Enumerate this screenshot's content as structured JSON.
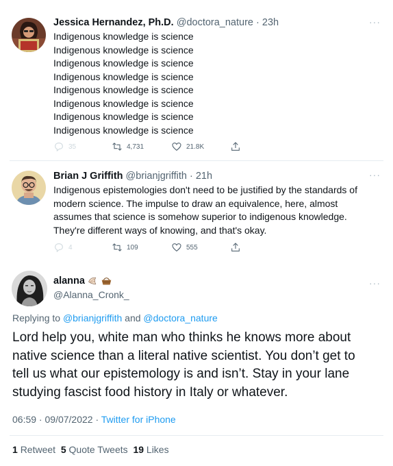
{
  "tweet1": {
    "name": "Jessica Hernandez, Ph.D.",
    "handle": "@doctora_nature",
    "time": "23h",
    "lines": [
      "Indigenous knowledge is science",
      "Indigenous knowledge is science",
      "Indigenous knowledge is science",
      "Indigenous knowledge is science",
      "Indigenous knowledge is science",
      "Indigenous knowledge is science",
      "Indigenous knowledge is science",
      "Indigenous knowledge is science"
    ],
    "replies": "35",
    "retweets": "4,731",
    "likes": "21.8K"
  },
  "tweet2": {
    "name": "Brian J Griffith",
    "handle": "@brianjgriffith",
    "time": "21h",
    "lines": [
      "Indigenous epistemologies don't need to be justified by the standards of",
      "modern science. The impulse to draw an equivalence, here, almost",
      "assumes that science is somehow superior to indigenous knowledge.",
      "They're different ways of knowing, and that's okay."
    ],
    "replies": "4",
    "retweets": "109",
    "likes": "555"
  },
  "tweet3": {
    "name": "alanna",
    "handle": "@Alanna_Cronk_",
    "replying_prefix": "Replying to",
    "replying_user1": "@brianjgriffith",
    "replying_and": "and",
    "replying_user2": "@doctora_nature",
    "lines": [
      "Lord help you, white man who thinks he knows more about",
      "native science than a literal native scientist. You don’t get to",
      "tell us what our epistemology is and isn’t. Stay in your lane",
      "studying fascist food history in Italy or whatever."
    ],
    "time": "06:59",
    "date": "09/07/2022",
    "source": "Twitter for iPhone",
    "retweets_count": "1",
    "retweets_label": "Retweet",
    "quotes_count": "5",
    "quotes_label": "Quote Tweets",
    "likes_count": "19",
    "likes_label": "Likes"
  },
  "icons": {
    "more": "more-dots-icon",
    "reply": "reply-icon",
    "retweet": "retweet-icon",
    "like": "heart-icon",
    "share": "share-icon",
    "emoji1": "seashell-emoji-icon",
    "emoji2": "basket-emoji-icon"
  },
  "colors": {
    "text": "#0f1419",
    "secondary": "#536471",
    "link": "#1d9bf0",
    "divider": "#e6ecf0"
  }
}
